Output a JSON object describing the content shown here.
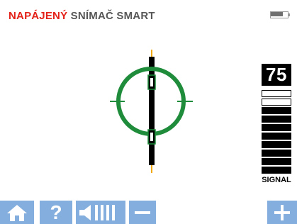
{
  "header": {
    "title_part1": "NAPÁJENÝ",
    "title_part2": "SNÍMAČ SMART"
  },
  "battery": {
    "level": 0.75,
    "icon": "battery-icon"
  },
  "signal": {
    "value": "75",
    "label": "SIGNAL",
    "meter": {
      "segments_total": 10,
      "segments_filled": 8
    }
  },
  "target": {
    "icon": "crosshair-target",
    "colors": {
      "ring": "#1e8c3a",
      "bar": "#000000",
      "tip": "#f2a900"
    }
  },
  "toolbar": {
    "buttons": [
      {
        "name": "home-button",
        "icon": "home-icon"
      },
      {
        "name": "help-button",
        "icon": "question-mark-icon",
        "label": "?"
      },
      {
        "name": "volume-button",
        "icon": "speaker-icon"
      },
      {
        "name": "minus-button",
        "icon": "minus-icon"
      },
      {
        "name": "plus-button",
        "icon": "plus-icon"
      }
    ]
  },
  "colors": {
    "title_accent": "#e32219",
    "title_text": "#575757",
    "toolbar_bg": "#84aedd"
  }
}
